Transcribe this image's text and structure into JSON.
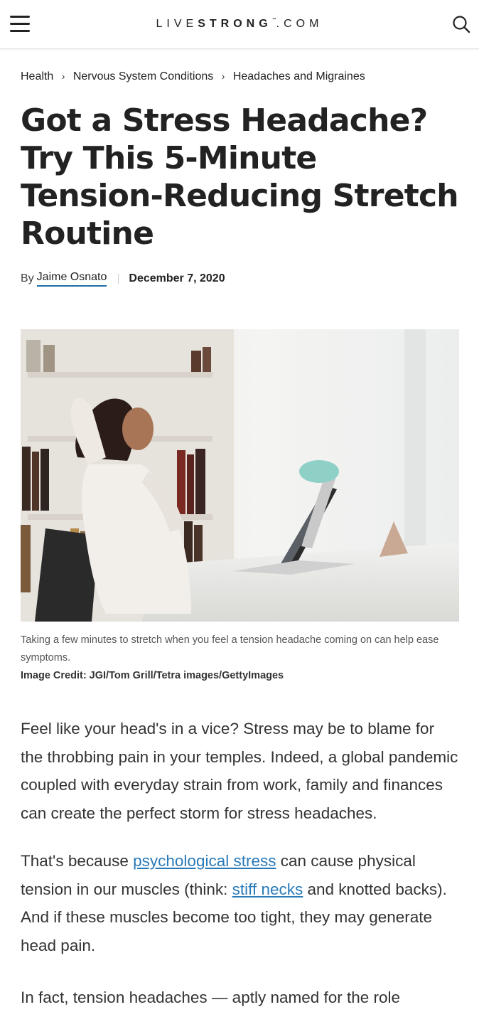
{
  "header": {
    "logo_bold_part": "STRONG",
    "logo_prefix": "LIVE",
    "logo_tm": "™",
    "logo_suffix": ".COM",
    "menu_icon": "hamburger-menu-icon",
    "search_icon": "search-icon"
  },
  "breadcrumb": [
    {
      "label": "Health"
    },
    {
      "label": "Nervous System Conditions"
    },
    {
      "label": "Headaches and Migraines"
    }
  ],
  "breadcrumb_separator": "›",
  "article": {
    "title": "Got a Stress Headache? Try This 5-Minute Tension-Reducing Stretch Routine",
    "byline_prefix": "By",
    "author": "Jaime Osnato",
    "date": "December 7, 2020",
    "image_caption": "Taking a few minutes to stretch when you feel a tension headache coming on can help ease symptoms.",
    "image_credit": "Image Credit: JGI/Tom Grill/Tetra images/GettyImages",
    "paragraph1": "Feel like your head's in a vice? Stress may be to blame for the throbbing pain in your temples. Indeed, a global pandemic coupled with everyday strain from work, family and finances can create the perfect storm for stress headaches.",
    "paragraph2": {
      "part1": "That's because ",
      "link1": "psychological stress",
      "part2": " can cause physical tension in our muscles (think: ",
      "link2": "stiff necks",
      "part3": " and knotted backs). And if these muscles become too tight, they may generate head pain."
    },
    "paragraph3": "In fact, tension headaches — aptly named for the role"
  },
  "colors": {
    "link": "#2a7ab8",
    "author_underline": "#1f6fa8",
    "text": "#222222"
  }
}
